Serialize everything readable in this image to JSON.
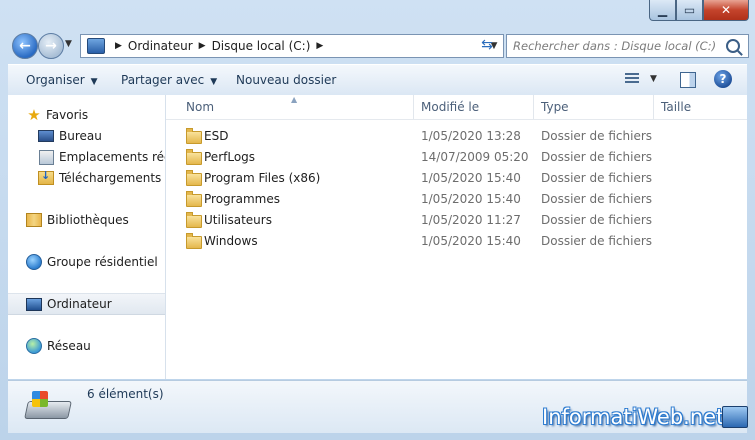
{
  "address": {
    "breadcrumbs": [
      "Ordinateur",
      "Disque local (C:)"
    ]
  },
  "search": {
    "placeholder": "Rechercher dans : Disque local (C:)"
  },
  "toolbar": {
    "organiser": "Organiser",
    "partager": "Partager avec",
    "nouveau_dossier": "Nouveau dossier"
  },
  "nav": {
    "favoris": "Favoris",
    "bureau": "Bureau",
    "emplacements": "Emplacements récents",
    "telechargements": "Téléchargements",
    "bibliotheques": "Bibliothèques",
    "groupe": "Groupe résidentiel",
    "ordinateur": "Ordinateur",
    "reseau": "Réseau"
  },
  "columns": {
    "nom": "Nom",
    "modifie": "Modifié le",
    "type": "Type",
    "taille": "Taille"
  },
  "files": [
    {
      "name": "ESD",
      "date": "1/05/2020 13:28",
      "type": "Dossier de fichiers"
    },
    {
      "name": "PerfLogs",
      "date": "14/07/2009 05:20",
      "type": "Dossier de fichiers"
    },
    {
      "name": "Program Files (x86)",
      "date": "1/05/2020 15:40",
      "type": "Dossier de fichiers"
    },
    {
      "name": "Programmes",
      "date": "1/05/2020 15:40",
      "type": "Dossier de fichiers"
    },
    {
      "name": "Utilisateurs",
      "date": "1/05/2020 11:27",
      "type": "Dossier de fichiers"
    },
    {
      "name": "Windows",
      "date": "1/05/2020 15:40",
      "type": "Dossier de fichiers"
    }
  ],
  "status": {
    "count": "6 élément(s)"
  },
  "watermark": "InformatiWeb.net",
  "colors": {
    "title_bg": "#cfe1f3",
    "close_red": "#c4442c",
    "selected_nav": "#e1e8f0"
  }
}
